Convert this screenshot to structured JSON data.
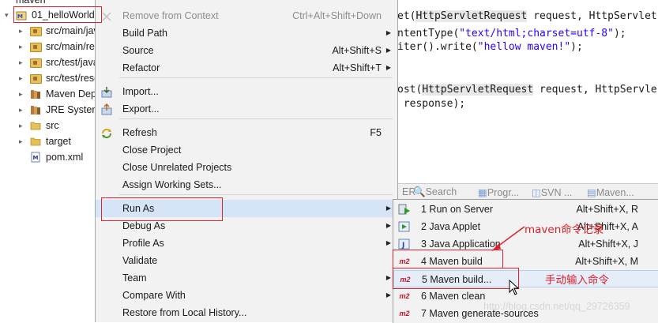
{
  "tree": {
    "root_parent": "maven",
    "project": "01_helloWorld",
    "items": [
      {
        "label": "src/main/java",
        "kind": "package-folder"
      },
      {
        "label": "src/main/resources",
        "kind": "package-folder"
      },
      {
        "label": "src/test/java",
        "kind": "package-folder"
      },
      {
        "label": "src/test/resources",
        "kind": "package-folder"
      },
      {
        "label": "Maven Dependencies",
        "kind": "library"
      },
      {
        "label": "JRE System Library",
        "kind": "library"
      },
      {
        "label": "src",
        "kind": "folder"
      },
      {
        "label": "target",
        "kind": "folder"
      },
      {
        "label": "pom.xml",
        "kind": "file"
      }
    ]
  },
  "editor": {
    "lines": [
      {
        "pre": "et(",
        "hl": "HttpServletRequest",
        "post": " request, HttpServlet"
      },
      {
        "pre": "ntentType(",
        "str": "\"text/html;charset=utf-8\"",
        "post": ");"
      },
      {
        "pre": "iter().write(",
        "str": "\"hellow maven!\"",
        "post": ");"
      },
      {
        "pre": "ost(",
        "hl": "HttpServletRequest",
        "post": " request, HttpServle"
      },
      {
        "pre": " response);"
      }
    ]
  },
  "view_tabs": [
    "Search",
    "Progr...",
    "SVN ...",
    "Maven..."
  ],
  "context_menu": {
    "items": [
      {
        "label": "Remove from Context",
        "shortcut": "Ctrl+Alt+Shift+Down",
        "disabled": true
      },
      {
        "label": "Build Path",
        "submenu": true
      },
      {
        "label": "Source",
        "shortcut": "Alt+Shift+S",
        "submenu": true
      },
      {
        "label": "Refactor",
        "shortcut": "Alt+Shift+T",
        "submenu": true
      },
      {
        "label": "Import...",
        "icon": "import-icon"
      },
      {
        "label": "Export...",
        "icon": "export-icon"
      },
      {
        "label": "Refresh",
        "shortcut": "F5",
        "icon": "refresh-icon"
      },
      {
        "label": "Close Project"
      },
      {
        "label": "Close Unrelated Projects"
      },
      {
        "label": "Assign Working Sets..."
      },
      {
        "label": "Run As",
        "submenu": true,
        "active": true
      },
      {
        "label": "Debug As",
        "submenu": true
      },
      {
        "label": "Profile As",
        "submenu": true
      },
      {
        "label": "Validate"
      },
      {
        "label": "Team",
        "submenu": true
      },
      {
        "label": "Compare With",
        "submenu": true
      },
      {
        "label": "Restore from Local History..."
      }
    ]
  },
  "run_as_submenu": {
    "items": [
      {
        "label": "1 Run on Server",
        "shortcut": "Alt+Shift+X, R",
        "icon": "server-run-icon"
      },
      {
        "label": "2 Java Applet",
        "shortcut": "Alt+Shift+X, A",
        "icon": "applet-icon"
      },
      {
        "label": "3 Java Application",
        "shortcut": "Alt+Shift+X, J",
        "icon": "java-app-icon"
      },
      {
        "label": "4 Maven build",
        "shortcut": "Alt+Shift+X, M",
        "icon": "m2-icon"
      },
      {
        "label": "5 Maven build...",
        "shortcut": "",
        "icon": "m2-icon",
        "hover": true
      },
      {
        "label": "6 Maven clean",
        "shortcut": "",
        "icon": "m2-icon"
      },
      {
        "label": "7 Maven generate-sources",
        "shortcut": "",
        "icon": "m2-icon"
      }
    ]
  },
  "annotations": {
    "note_record": "maven命令记录",
    "note_manual": "手动输入命令",
    "watermark": "http://blog.csdn.net/qq_29726359"
  },
  "colors": {
    "annotation_red": "#e0202a",
    "menu_bg": "#f2f2f2",
    "active_bg": "#d5e5f7",
    "m2_red": "#c8102e"
  }
}
